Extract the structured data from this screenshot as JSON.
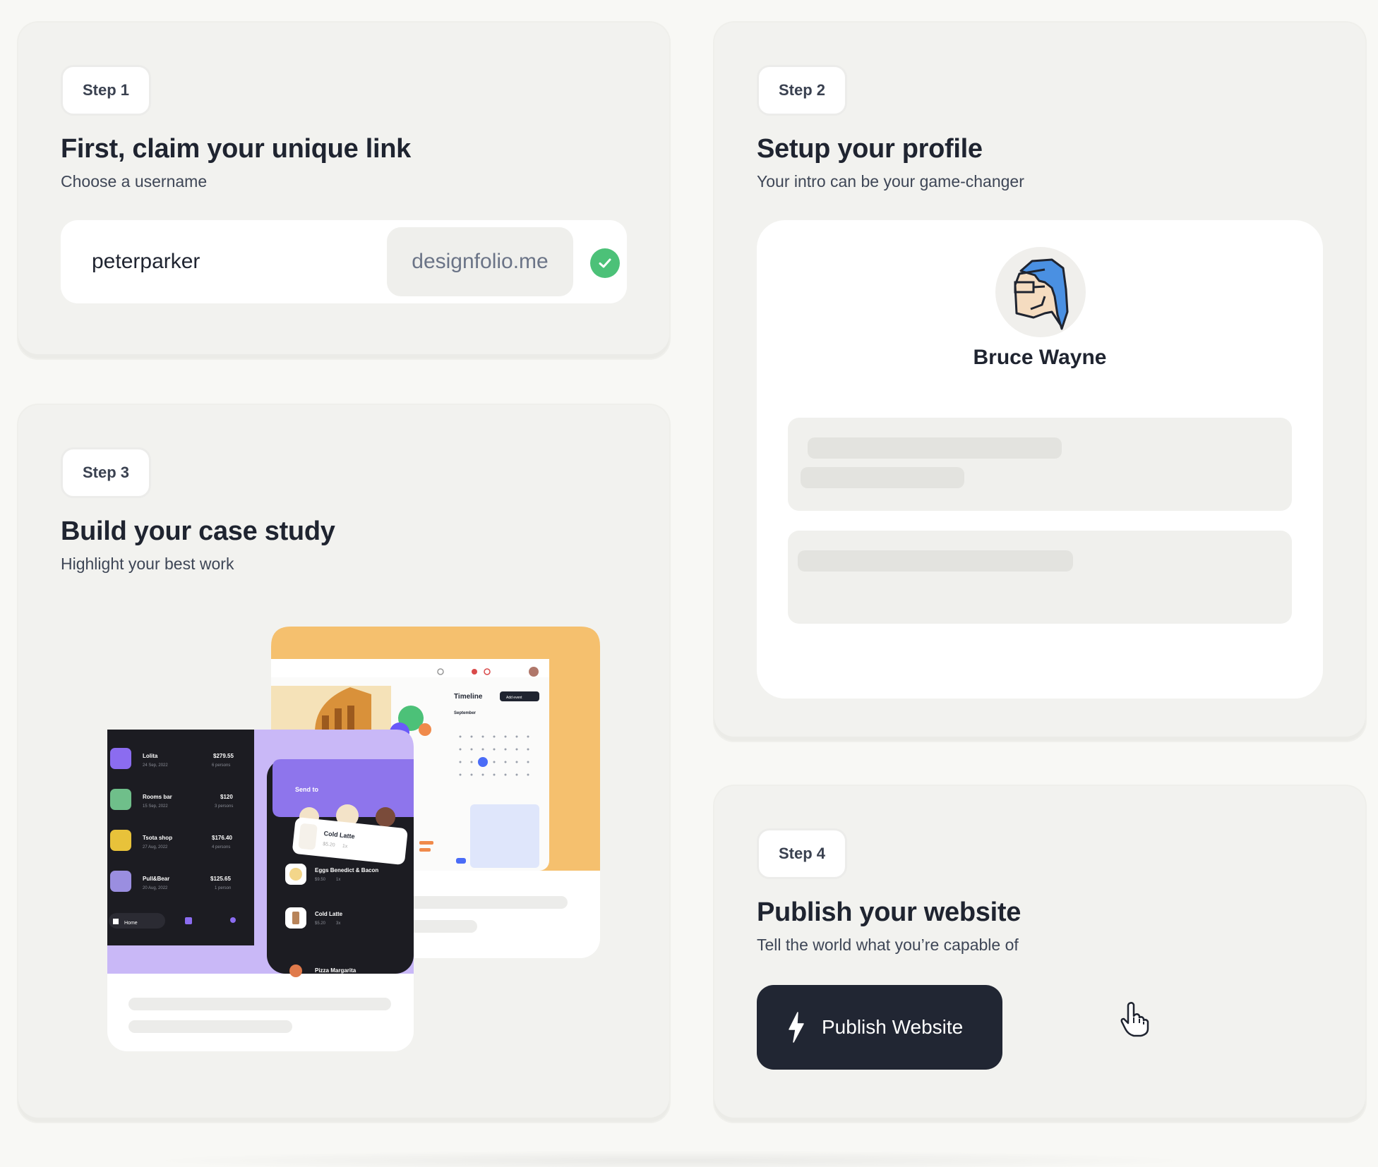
{
  "step1": {
    "step_label": "Step 1",
    "title": "First, claim your unique link",
    "subtitle": "Choose a username",
    "username_value": "peterparker",
    "domain": "designfolio.me"
  },
  "step2": {
    "step_label": "Step 2",
    "title": "Setup your profile",
    "subtitle": "Your intro can be your game-changer",
    "profile_name": "Bruce Wayne"
  },
  "step3": {
    "step_label": "Step 3",
    "title": "Build your case study",
    "subtitle": "Highlight your best work",
    "mockup": {
      "timeline_title": "Timeline",
      "timeline_button": "Add event",
      "month": "September",
      "send_to": "Send to",
      "featured_item": {
        "name": "Cold Latte",
        "price": "$5.20",
        "qty": "1x"
      },
      "transactions": [
        {
          "name": "Lolita",
          "date": "24 Sep, 2022",
          "amount": "$279.55",
          "people": "6 persons",
          "color": "#8b6cf0"
        },
        {
          "name": "Rooms bar",
          "date": "15 Sep, 2022",
          "amount": "$120",
          "people": "3 persons",
          "color": "#6fbf8a"
        },
        {
          "name": "Tsota shop",
          "date": "27 Aug, 2022",
          "amount": "$176.40",
          "people": "4 persons",
          "color": "#e8c23a"
        },
        {
          "name": "Pull&Bear",
          "date": "20 Aug, 2022",
          "amount": "$125.65",
          "people": "1 person",
          "color": "#9a8ee0"
        }
      ],
      "nav_home": "Home",
      "orders": [
        {
          "name": "Eggs Benedict & Bacon",
          "price": "$9.50",
          "qty": "1x"
        },
        {
          "name": "Cold Latte",
          "price": "$5.20",
          "qty": "3x"
        },
        {
          "name": "Pizza Margarita",
          "price": "",
          "qty": ""
        }
      ]
    }
  },
  "step4": {
    "step_label": "Step 4",
    "title": "Publish your website",
    "subtitle": "Tell the world what you’re capable of",
    "button_label": "Publish Website"
  },
  "colors": {
    "card_bg": "#f2f2ef",
    "dark_button": "#212633",
    "success": "#4cc178",
    "accent_orange": "#f5c06e",
    "accent_purple": "#c9b8f7"
  },
  "icons": {
    "check": "check-circle-icon",
    "bolt": "lightning-bolt-icon",
    "cursor": "hand-pointer-icon"
  }
}
